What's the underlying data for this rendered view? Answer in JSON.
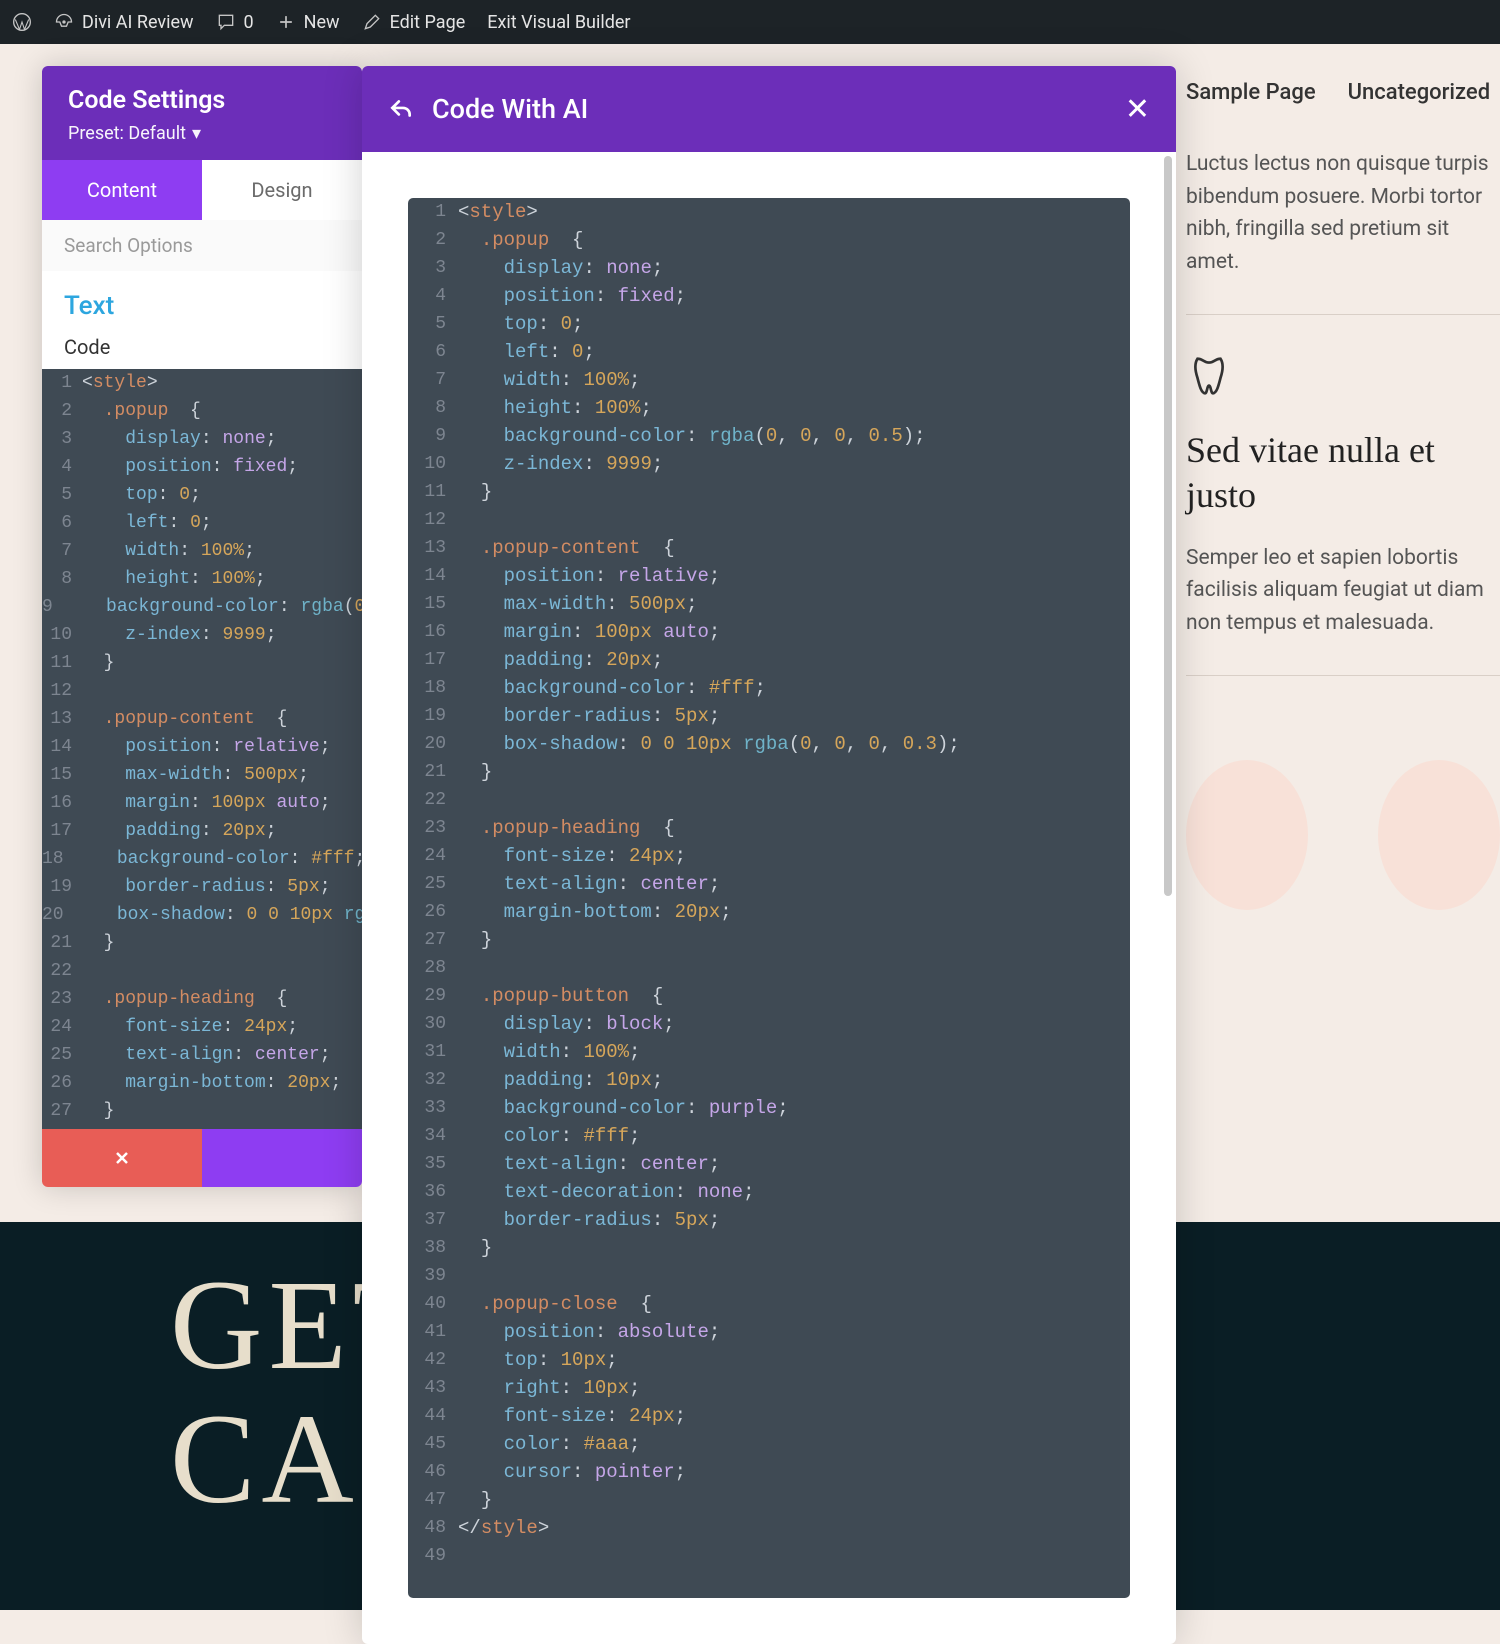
{
  "wpbar": {
    "site_title": "Divi AI Review",
    "comments_count": "0",
    "new_label": "New",
    "edit_page_label": "Edit Page",
    "exit_vb_label": "Exit Visual Builder"
  },
  "nav": {
    "sample_page": "Sample Page",
    "uncategorized": "Uncategorized"
  },
  "right": {
    "para1": "Luctus lectus non quisque turpis bibendum posuere. Morbi tortor nibh, fringilla sed pretium sit amet.",
    "para2_title": "Sed vitae nulla et justo",
    "para2": "Semper leo et sapien lobortis facilisis aliquam feugiat ut diam non tempus et malesuada."
  },
  "hero": {
    "line": "GET\nCAR"
  },
  "panel": {
    "title": "Code Settings",
    "preset_label": "Preset: Default",
    "tab_content": "Content",
    "tab_design": "Design",
    "search_placeholder": "Search Options",
    "section_text": "Text",
    "field_code": "Code"
  },
  "ai": {
    "title": "Code With AI",
    "close": "✕"
  },
  "code_lines": [
    {
      "n": 1,
      "html": "<span class='t-punc'>&lt;</span><span class='t-tag'>style</span><span class='t-punc'>&gt;</span>"
    },
    {
      "n": 2,
      "html": "  <span class='t-sel'>.popup</span>  <span class='t-punc'>{</span>"
    },
    {
      "n": 3,
      "html": "    <span class='t-prop'>display</span><span class='t-punc'>:</span> <span class='t-val'>none</span><span class='t-punc'>;</span>"
    },
    {
      "n": 4,
      "html": "    <span class='t-prop'>position</span><span class='t-punc'>:</span> <span class='t-val'>fixed</span><span class='t-punc'>;</span>"
    },
    {
      "n": 5,
      "html": "    <span class='t-prop'>top</span><span class='t-punc'>:</span> <span class='t-num'>0</span><span class='t-punc'>;</span>"
    },
    {
      "n": 6,
      "html": "    <span class='t-prop'>left</span><span class='t-punc'>:</span> <span class='t-num'>0</span><span class='t-punc'>;</span>"
    },
    {
      "n": 7,
      "html": "    <span class='t-prop'>width</span><span class='t-punc'>:</span> <span class='t-num'>100%</span><span class='t-punc'>;</span>"
    },
    {
      "n": 8,
      "html": "    <span class='t-prop'>height</span><span class='t-punc'>:</span> <span class='t-num'>100%</span><span class='t-punc'>;</span>"
    },
    {
      "n": 9,
      "html": "    <span class='t-prop'>background-color</span><span class='t-punc'>:</span> <span class='t-fn'>rgba</span><span class='t-punc'>(</span><span class='t-num'>0</span><span class='t-punc'>, </span><span class='t-num'>0</span><span class='t-punc'>, </span><span class='t-num'>0</span><span class='t-punc'>, </span><span class='t-num'>0.5</span><span class='t-punc'>);</span>"
    },
    {
      "n": 10,
      "html": "    <span class='t-prop'>z-index</span><span class='t-punc'>:</span> <span class='t-num'>9999</span><span class='t-punc'>;</span>"
    },
    {
      "n": 11,
      "html": "  <span class='t-punc'>}</span>"
    },
    {
      "n": 12,
      "html": " "
    },
    {
      "n": 13,
      "html": "  <span class='t-sel'>.popup-content</span>  <span class='t-punc'>{</span>"
    },
    {
      "n": 14,
      "html": "    <span class='t-prop'>position</span><span class='t-punc'>:</span> <span class='t-val'>relative</span><span class='t-punc'>;</span>"
    },
    {
      "n": 15,
      "html": "    <span class='t-prop'>max-width</span><span class='t-punc'>:</span> <span class='t-num'>500px</span><span class='t-punc'>;</span>"
    },
    {
      "n": 16,
      "html": "    <span class='t-prop'>margin</span><span class='t-punc'>:</span> <span class='t-num'>100px</span> <span class='t-val'>auto</span><span class='t-punc'>;</span>"
    },
    {
      "n": 17,
      "html": "    <span class='t-prop'>padding</span><span class='t-punc'>:</span> <span class='t-num'>20px</span><span class='t-punc'>;</span>"
    },
    {
      "n": 18,
      "html": "    <span class='t-prop'>background-color</span><span class='t-punc'>:</span> <span class='t-num'>#fff</span><span class='t-punc'>;</span>"
    },
    {
      "n": 19,
      "html": "    <span class='t-prop'>border-radius</span><span class='t-punc'>:</span> <span class='t-num'>5px</span><span class='t-punc'>;</span>"
    },
    {
      "n": 20,
      "html": "    <span class='t-prop'>box-shadow</span><span class='t-punc'>:</span> <span class='t-num'>0 0 10px</span> <span class='t-fn'>rgba</span><span class='t-punc'>(</span><span class='t-num'>0</span><span class='t-punc'>, </span><span class='t-num'>0</span><span class='t-punc'>, </span><span class='t-num'>0</span><span class='t-punc'>, </span><span class='t-num'>0.3</span><span class='t-punc'>);</span>"
    },
    {
      "n": 21,
      "html": "  <span class='t-punc'>}</span>"
    },
    {
      "n": 22,
      "html": " "
    },
    {
      "n": 23,
      "html": "  <span class='t-sel'>.popup-heading</span>  <span class='t-punc'>{</span>"
    },
    {
      "n": 24,
      "html": "    <span class='t-prop'>font-size</span><span class='t-punc'>:</span> <span class='t-num'>24px</span><span class='t-punc'>;</span>"
    },
    {
      "n": 25,
      "html": "    <span class='t-prop'>text-align</span><span class='t-punc'>:</span> <span class='t-val'>center</span><span class='t-punc'>;</span>"
    },
    {
      "n": 26,
      "html": "    <span class='t-prop'>margin-bottom</span><span class='t-punc'>:</span> <span class='t-num'>20px</span><span class='t-punc'>;</span>"
    },
    {
      "n": 27,
      "html": "  <span class='t-punc'>}</span>"
    },
    {
      "n": 28,
      "html": " "
    },
    {
      "n": 29,
      "html": "  <span class='t-sel'>.popup-button</span>  <span class='t-punc'>{</span>"
    },
    {
      "n": 30,
      "html": "    <span class='t-prop'>display</span><span class='t-punc'>:</span> <span class='t-val'>block</span><span class='t-punc'>;</span>"
    },
    {
      "n": 31,
      "html": "    <span class='t-prop'>width</span><span class='t-punc'>:</span> <span class='t-num'>100%</span><span class='t-punc'>;</span>"
    },
    {
      "n": 32,
      "html": "    <span class='t-prop'>padding</span><span class='t-punc'>:</span> <span class='t-num'>10px</span><span class='t-punc'>;</span>"
    },
    {
      "n": 33,
      "html": "    <span class='t-prop'>background-color</span><span class='t-punc'>:</span> <span class='t-val'>purple</span><span class='t-punc'>;</span>"
    },
    {
      "n": 34,
      "html": "    <span class='t-prop'>color</span><span class='t-punc'>:</span> <span class='t-num'>#fff</span><span class='t-punc'>;</span>"
    },
    {
      "n": 35,
      "html": "    <span class='t-prop'>text-align</span><span class='t-punc'>:</span> <span class='t-val'>center</span><span class='t-punc'>;</span>"
    },
    {
      "n": 36,
      "html": "    <span class='t-prop'>text-decoration</span><span class='t-punc'>:</span> <span class='t-val'>none</span><span class='t-punc'>;</span>"
    },
    {
      "n": 37,
      "html": "    <span class='t-prop'>border-radius</span><span class='t-punc'>:</span> <span class='t-num'>5px</span><span class='t-punc'>;</span>"
    },
    {
      "n": 38,
      "html": "  <span class='t-punc'>}</span>"
    },
    {
      "n": 39,
      "html": " "
    },
    {
      "n": 40,
      "html": "  <span class='t-sel'>.popup-close</span>  <span class='t-punc'>{</span>"
    },
    {
      "n": 41,
      "html": "    <span class='t-prop'>position</span><span class='t-punc'>:</span> <span class='t-val'>absolute</span><span class='t-punc'>;</span>"
    },
    {
      "n": 42,
      "html": "    <span class='t-prop'>top</span><span class='t-punc'>:</span> <span class='t-num'>10px</span><span class='t-punc'>;</span>"
    },
    {
      "n": 43,
      "html": "    <span class='t-prop'>right</span><span class='t-punc'>:</span> <span class='t-num'>10px</span><span class='t-punc'>;</span>"
    },
    {
      "n": 44,
      "html": "    <span class='t-prop'>font-size</span><span class='t-punc'>:</span> <span class='t-num'>24px</span><span class='t-punc'>;</span>"
    },
    {
      "n": 45,
      "html": "    <span class='t-prop'>color</span><span class='t-punc'>:</span> <span class='t-num'>#aaa</span><span class='t-punc'>;</span>"
    },
    {
      "n": 46,
      "html": "    <span class='t-prop'>cursor</span><span class='t-punc'>:</span> <span class='t-val'>pointer</span><span class='t-punc'>;</span>"
    },
    {
      "n": 47,
      "html": "  <span class='t-punc'>}</span>"
    },
    {
      "n": 48,
      "html": "<span class='t-punc'>&lt;/</span><span class='t-tag'>style</span><span class='t-punc'>&gt;</span>"
    },
    {
      "n": 49,
      "html": " "
    }
  ],
  "panel_visible_lines": 27
}
